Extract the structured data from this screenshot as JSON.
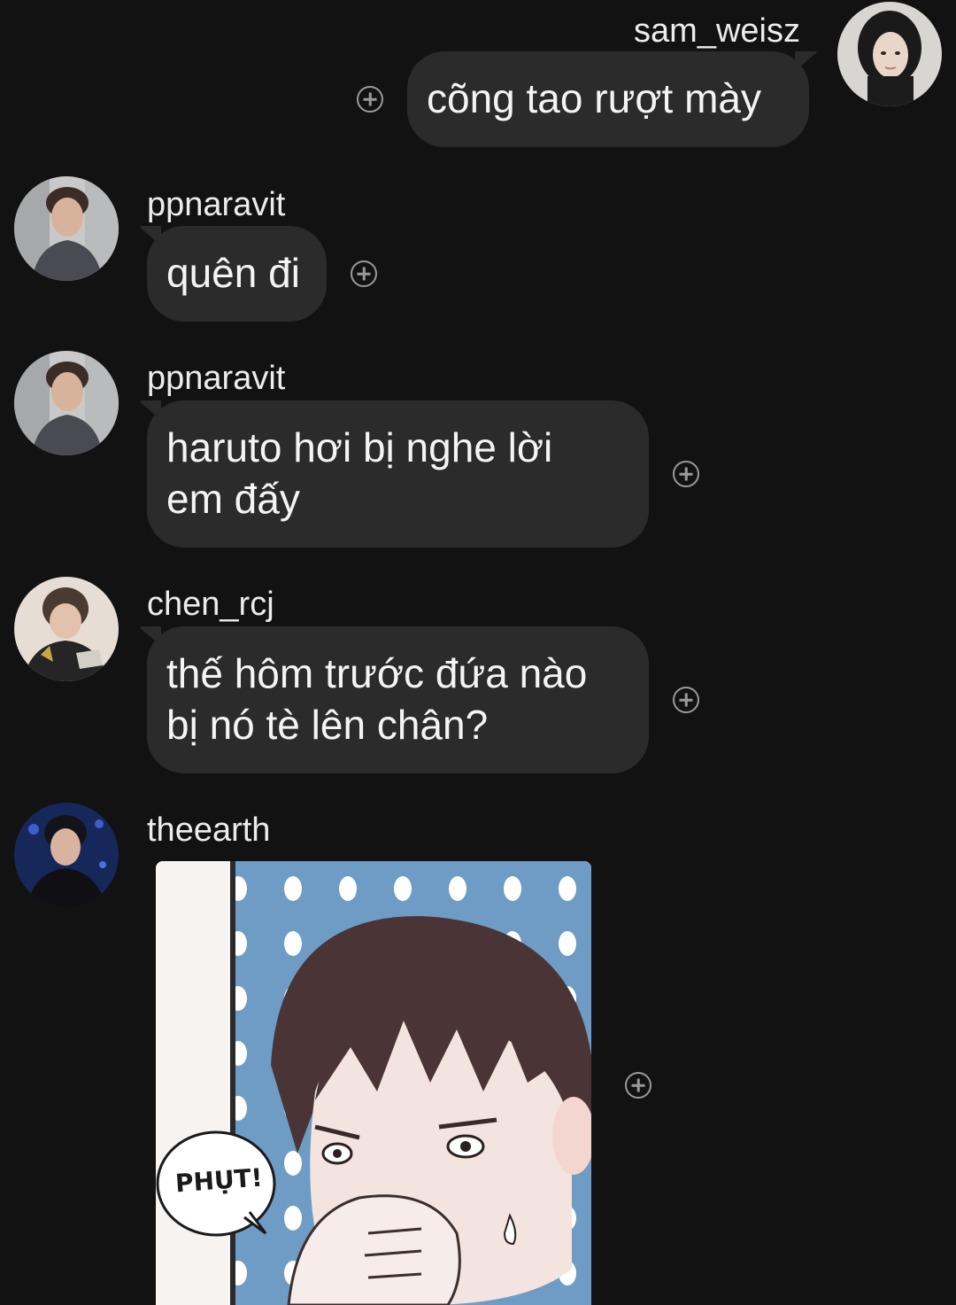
{
  "messages": [
    {
      "username": "sam_weisz",
      "text": "cõng tao rượt mày",
      "side": "right"
    },
    {
      "username": "ppnaravit",
      "text": "quên đi",
      "side": "left"
    },
    {
      "username": "ppnaravit",
      "text_line1": "haruto hơi bị nghe lời",
      "text_line2": "em đấy",
      "side": "left"
    },
    {
      "username": "chen_rcj",
      "text_line1": "thế hôm trước đứa nào",
      "text_line2": "bị nó tè lên chân?",
      "side": "left"
    },
    {
      "username": "theearth",
      "sticker_text": "PHỤT!",
      "side": "left"
    }
  ],
  "colors": {
    "background": "#121212",
    "bubble": "#2b2b2b",
    "text": "#f4f4f4",
    "reaction_icon": "#9a9a9a"
  },
  "icons": {
    "reaction": "add-reaction-icon"
  }
}
